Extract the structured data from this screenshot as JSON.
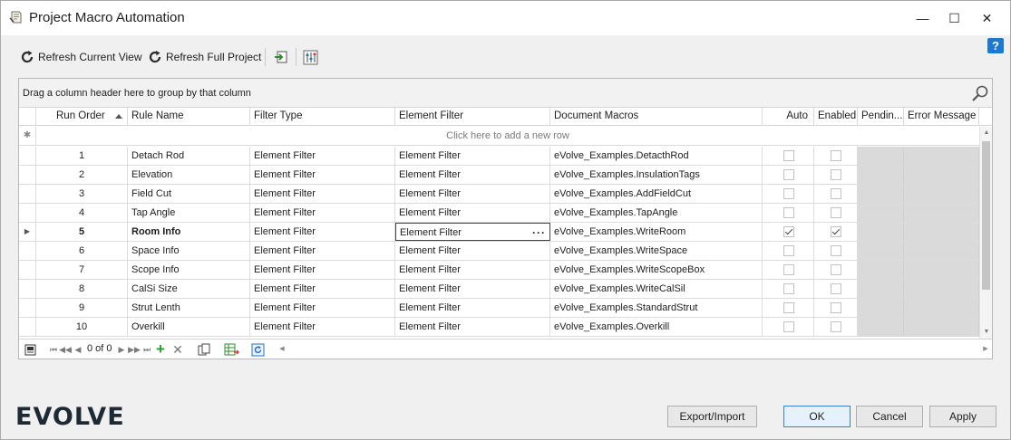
{
  "window": {
    "title": "Project Macro Automation",
    "minimize_glyph": "—",
    "maximize_glyph": "☐",
    "close_glyph": "✕"
  },
  "help": {
    "label": "?"
  },
  "toolbar": {
    "refresh_current_label": "Refresh Current View",
    "refresh_full_label": "Refresh Full Project"
  },
  "grid": {
    "group_panel_text": "Drag a column header here to group by that column",
    "new_row_text": "Click here to add a new row",
    "sorted_column": "Run Order",
    "columns": [
      "Run Order",
      "Rule Name",
      "Filter Type",
      "Element Filter",
      "Document Macros",
      "Auto",
      "Enabled",
      "Pendin...",
      "Error Message"
    ],
    "current_row_index": 4,
    "rows": [
      {
        "run_order": "1",
        "rule_name": "Detach Rod",
        "filter_type": "Element Filter",
        "element_filter": "Element Filter",
        "document_macros": "eVolve_Examples.DetacthRod",
        "auto": false,
        "enabled": false
      },
      {
        "run_order": "2",
        "rule_name": "Elevation",
        "filter_type": "Element Filter",
        "element_filter": "Element Filter",
        "document_macros": "eVolve_Examples.InsulationTags",
        "auto": false,
        "enabled": false
      },
      {
        "run_order": "3",
        "rule_name": "Field Cut",
        "filter_type": "Element Filter",
        "element_filter": "Element Filter",
        "document_macros": "eVolve_Examples.AddFieldCut",
        "auto": false,
        "enabled": false
      },
      {
        "run_order": "4",
        "rule_name": "Tap Angle",
        "filter_type": "Element Filter",
        "element_filter": "Element Filter",
        "document_macros": "eVolve_Examples.TapAngle",
        "auto": false,
        "enabled": false
      },
      {
        "run_order": "5",
        "rule_name": "Room Info",
        "filter_type": "Element Filter",
        "element_filter": "Element Filter",
        "document_macros": "eVolve_Examples.WriteRoom",
        "auto": true,
        "enabled": true
      },
      {
        "run_order": "6",
        "rule_name": "Space Info",
        "filter_type": "Element Filter",
        "element_filter": "Element Filter",
        "document_macros": "eVolve_Examples.WriteSpace",
        "auto": false,
        "enabled": false
      },
      {
        "run_order": "7",
        "rule_name": "Scope Info",
        "filter_type": "Element Filter",
        "element_filter": "Element Filter",
        "document_macros": "eVolve_Examples.WriteScopeBox",
        "auto": false,
        "enabled": false
      },
      {
        "run_order": "8",
        "rule_name": "CalSi Size",
        "filter_type": "Element Filter",
        "element_filter": "Element Filter",
        "document_macros": "eVolve_Examples.WriteCalSil",
        "auto": false,
        "enabled": false
      },
      {
        "run_order": "9",
        "rule_name": "Strut Lenth",
        "filter_type": "Element Filter",
        "element_filter": "Element Filter",
        "document_macros": "eVolve_Examples.StandardStrut",
        "auto": false,
        "enabled": false
      },
      {
        "run_order": "10",
        "rule_name": "Overkill",
        "filter_type": "Element Filter",
        "element_filter": "Element Filter",
        "document_macros": "eVolve_Examples.Overkill",
        "auto": false,
        "enabled": false
      }
    ],
    "editor_button_glyph": "···"
  },
  "navigator": {
    "record_count": "0 of 0",
    "first_glyph": "⏮",
    "prev_page_glyph": "◀◀",
    "prev_glyph": "◀",
    "next_glyph": "▶",
    "next_page_glyph": "▶▶",
    "last_glyph": "⏭",
    "add_glyph": "+",
    "delete_glyph": "✕"
  },
  "footer": {
    "logo_text": "EVOLVE",
    "export_import_label": "Export/Import",
    "ok_label": "OK",
    "cancel_label": "Cancel",
    "apply_label": "Apply"
  },
  "colors": {
    "accent_blue": "#1c78d1",
    "locked_cell_gray": "#dadada"
  }
}
